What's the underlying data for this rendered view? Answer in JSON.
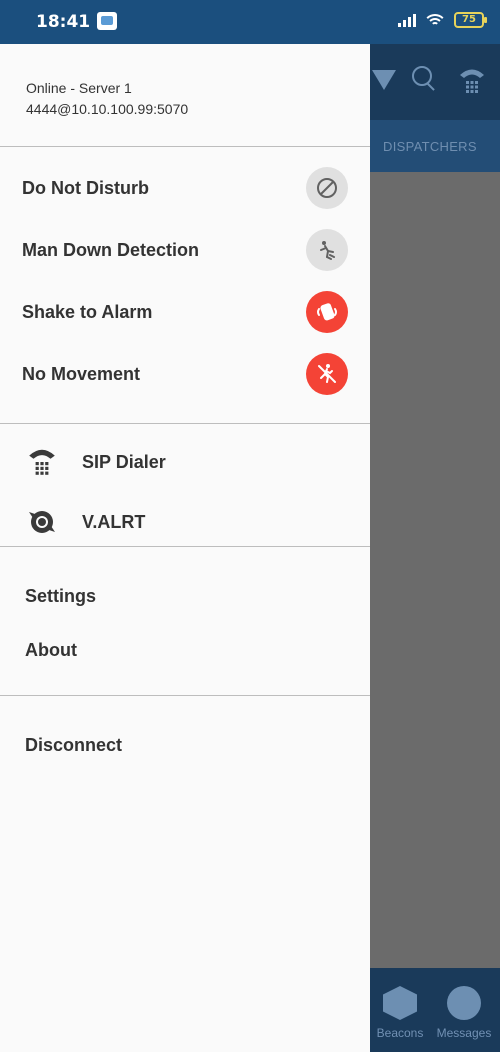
{
  "status_bar": {
    "time": "18:41",
    "battery": "75"
  },
  "background_app": {
    "tab_label": "DISPATCHERS",
    "bottom_nav": [
      {
        "label": "Beacons",
        "icon": "beacon-warning-icon"
      },
      {
        "label": "Messages",
        "icon": "chat-bubble-icon"
      }
    ]
  },
  "drawer": {
    "connection_status": "Online - Server 1",
    "sip_address": "4444@10.10.100.99:5070",
    "status_items": [
      {
        "label": "Do Not Disturb",
        "icon": "block-icon",
        "state": "off",
        "color": "#e0e0e0"
      },
      {
        "label": "Man Down Detection",
        "icon": "fall-person-icon",
        "state": "off",
        "color": "#e0e0e0"
      },
      {
        "label": "Shake to Alarm",
        "icon": "shake-phone-icon",
        "state": "on",
        "color": "#f44336"
      },
      {
        "label": "No Movement",
        "icon": "no-movement-icon",
        "state": "on",
        "color": "#f44336"
      }
    ],
    "nav_items": [
      {
        "label": "SIP Dialer",
        "icon": "dialer-phone-icon"
      },
      {
        "label": "V.ALRT",
        "icon": "valrt-device-icon"
      }
    ],
    "menu_items": [
      {
        "label": "Settings"
      },
      {
        "label": "About"
      }
    ],
    "disconnect_label": "Disconnect"
  }
}
